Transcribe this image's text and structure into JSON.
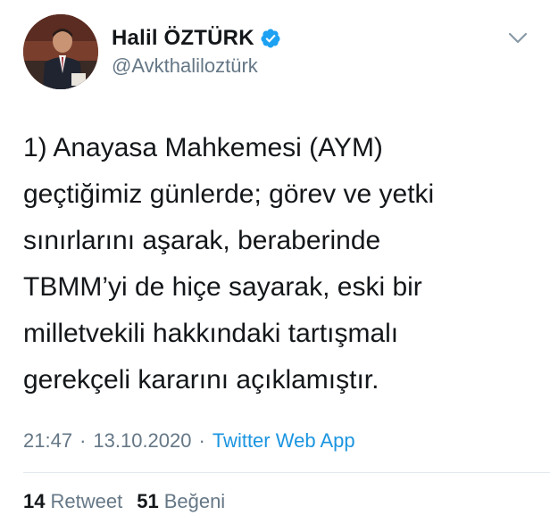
{
  "tweet": {
    "author": {
      "display_name": "Halil ÖZTÜRK",
      "handle": "@Avkthaliloztürk",
      "verified": true,
      "verified_icon": "verified-badge-icon",
      "avatar_icon": "profile-photo"
    },
    "menu_icon": "chevron-down-icon",
    "text": "1) Anayasa Mahkemesi (AYM)\ngeçtiğimiz günlerde; görev ve yetki\nsınırlarını aşarak, beraberinde\nTBMM’yi de hiçe sayarak, eski bir\nmilletvekili hakkındaki tartışmalı\ngerekçeli kararını açıklamıştır.",
    "time": "21:47",
    "separator": "·",
    "date": "13.10.2020",
    "source": "Twitter Web App",
    "stats": {
      "retweet_count": "14",
      "retweet_label": "Retweet",
      "like_count": "51",
      "like_label": "Beğeni"
    }
  },
  "colors": {
    "text_primary": "#14171a",
    "text_secondary": "#657786",
    "link": "#1b95e0",
    "verified": "#1da1f2",
    "divider": "#e1e8ed"
  }
}
